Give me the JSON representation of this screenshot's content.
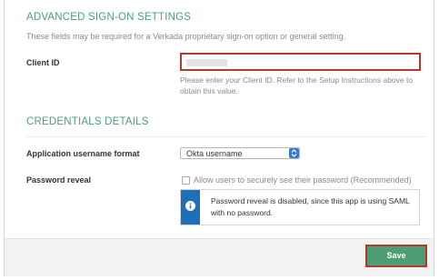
{
  "advanced": {
    "title": "ADVANCED SIGN-ON SETTINGS",
    "subtitle": "These fields may be required for a Verkada proprietary sign-on option or general setting.",
    "client_id": {
      "label": "Client ID",
      "value": "",
      "help": "Please enter your Client ID. Refer to the Setup Instructions above to obtain this value."
    }
  },
  "credentials": {
    "title": "CREDENTIALS DETAILS",
    "username_format": {
      "label": "Application username format",
      "selected": "Okta username"
    },
    "password_reveal": {
      "label": "Password reveal",
      "checkbox_label": "Allow users to securely see their password (Recommended)",
      "checked": false,
      "info_message": "Password reveal is disabled, since this app is using SAML with no password."
    }
  },
  "footer": {
    "save_label": "Save"
  },
  "colors": {
    "accent_green": "#4e9e75",
    "highlight_red": "#b33b2b",
    "info_blue": "#1c6fb8",
    "select_blue": "#3b78d4"
  },
  "icons": {
    "select": "chevron-updown-icon",
    "info": "info-icon"
  }
}
